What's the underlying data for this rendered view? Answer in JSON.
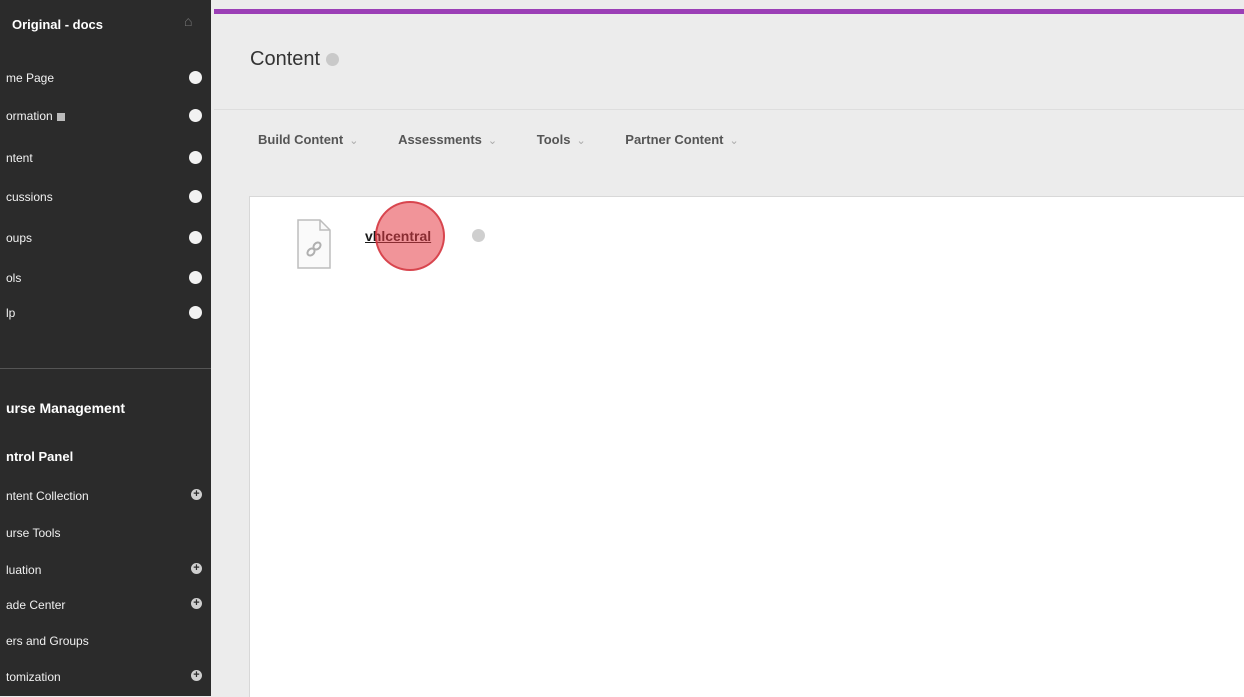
{
  "sidebar": {
    "course_title": "Original - docs",
    "menu_items": [
      {
        "label": "me Page",
        "has_square": false
      },
      {
        "label": "ormation",
        "has_square": true
      },
      {
        "label": "ntent",
        "has_square": false
      },
      {
        "label": "cussions",
        "has_square": false
      },
      {
        "label": "oups",
        "has_square": false
      },
      {
        "label": "ols",
        "has_square": false
      },
      {
        "label": "lp",
        "has_square": false
      }
    ],
    "course_management_heading": "urse Management",
    "control_panel_heading": "ntrol Panel",
    "control_panel_items": [
      {
        "label": "ntent Collection",
        "expandable": true
      },
      {
        "label": "urse Tools",
        "expandable": false
      },
      {
        "label": "luation",
        "expandable": true
      },
      {
        "label": "ade Center",
        "expandable": true
      },
      {
        "label": "ers and Groups",
        "expandable": false
      },
      {
        "label": "tomization",
        "expandable": true
      }
    ]
  },
  "main": {
    "page_title": "Content",
    "action_bar": [
      {
        "label": "Build Content"
      },
      {
        "label": "Assessments"
      },
      {
        "label": "Tools"
      },
      {
        "label": "Partner Content"
      }
    ],
    "content_items": [
      {
        "title": "vhlcentral",
        "icon": "link-file-icon"
      }
    ]
  },
  "colors": {
    "accent_bar": "#9b3fb6",
    "sidebar_bg": "#2b2b2b",
    "click_marker": "#e63c46"
  }
}
